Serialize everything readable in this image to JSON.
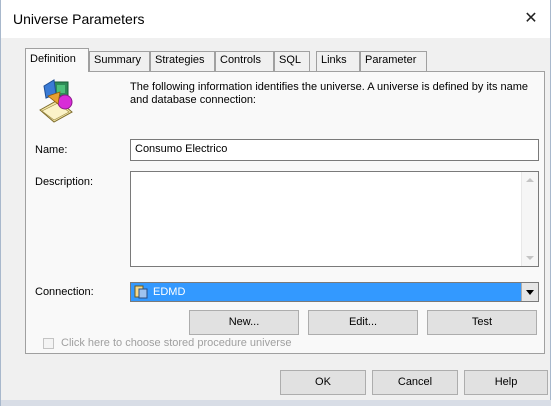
{
  "window": {
    "title": "Universe Parameters",
    "close_glyph": "✕"
  },
  "tabs": [
    {
      "label": "Definition",
      "active": true
    },
    {
      "label": "Summary"
    },
    {
      "label": "Strategies"
    },
    {
      "label": "Controls"
    },
    {
      "label": "SQL"
    },
    {
      "label": "Links"
    },
    {
      "label": "Parameter"
    }
  ],
  "definition": {
    "intro": "The following information identifies the universe. A universe is defined by its name and database connection:",
    "name_label": "Name:",
    "name_value": "Consumo Electrico",
    "description_label": "Description:",
    "description_value": "",
    "connection_label": "Connection:",
    "connection_value": "EDMD",
    "new_button": "New...",
    "edit_button": "Edit...",
    "test_button": "Test",
    "stored_procedure_label": "Click here to choose stored procedure universe"
  },
  "footer": {
    "ok": "OK",
    "cancel": "Cancel",
    "help": "Help"
  },
  "colors": {
    "selection": "#3399ff",
    "panel": "#f9f9f9",
    "dialog": "#f0f0f0"
  },
  "icons": [
    "universe-icon",
    "connection-icon",
    "close-icon",
    "dropdown-arrow-icon"
  ]
}
